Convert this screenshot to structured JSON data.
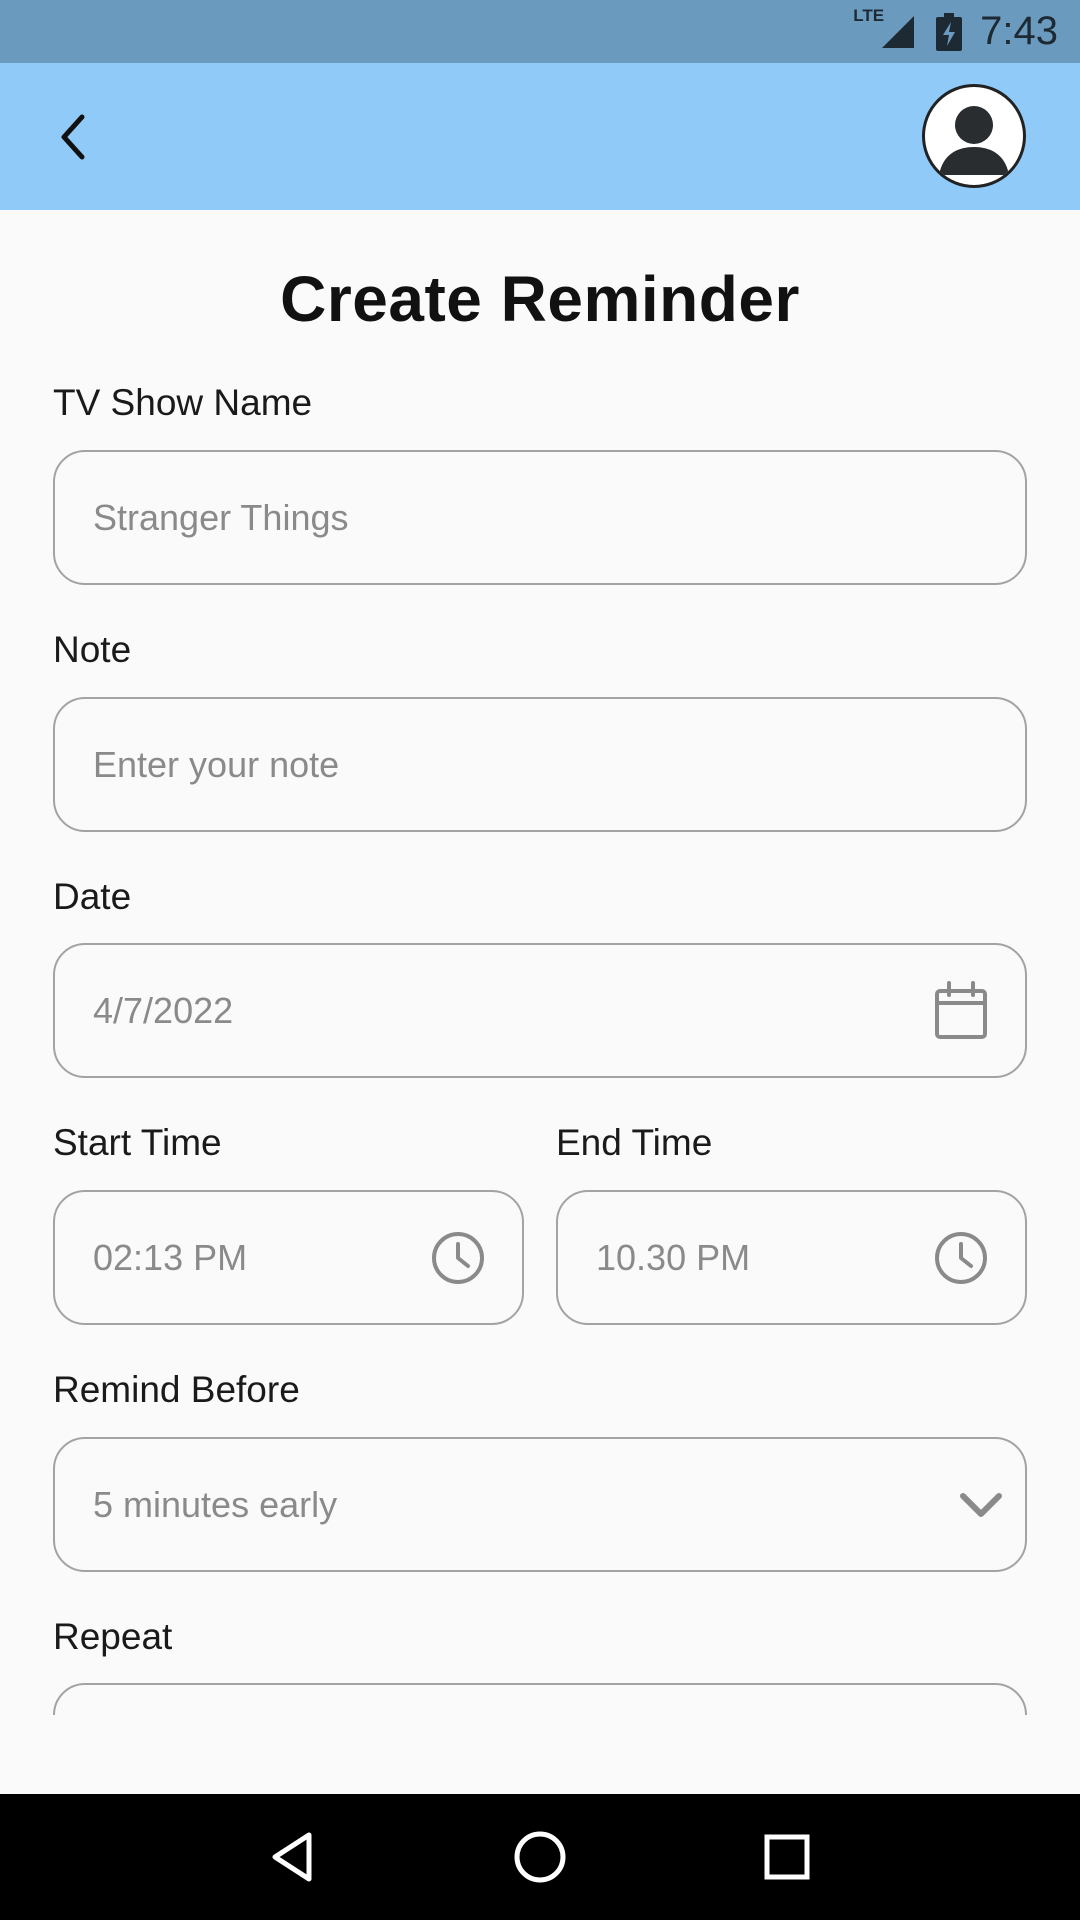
{
  "status_bar": {
    "network": "LTE",
    "time": "7:43"
  },
  "app_bar": {
    "back_icon": "chevron-left-icon",
    "avatar_icon": "person-icon"
  },
  "page": {
    "title": "Create Reminder"
  },
  "form": {
    "show_name": {
      "label": "TV Show Name",
      "placeholder": "Stranger Things",
      "value": ""
    },
    "note": {
      "label": "Note",
      "placeholder": "Enter your note",
      "value": ""
    },
    "date": {
      "label": "Date",
      "value": "4/7/2022",
      "icon": "calendar-icon"
    },
    "start_time": {
      "label": "Start Time",
      "value": "02:13 PM",
      "icon": "clock-icon"
    },
    "end_time": {
      "label": "End Time",
      "value": "10.30 PM",
      "icon": "clock-icon"
    },
    "remind_before": {
      "label": "Remind Before",
      "value": "5 minutes early",
      "icon": "chevron-down-icon"
    },
    "repeat": {
      "label": "Repeat"
    }
  },
  "nav_bar": {
    "back_icon": "triangle-back-icon",
    "home_icon": "circle-home-icon",
    "recents_icon": "square-recents-icon"
  },
  "colors": {
    "app_bar": "#90caf9",
    "status_bar": "#6b9abf",
    "field_border": "#a3a3a3",
    "placeholder_text": "#8a8a8a"
  }
}
